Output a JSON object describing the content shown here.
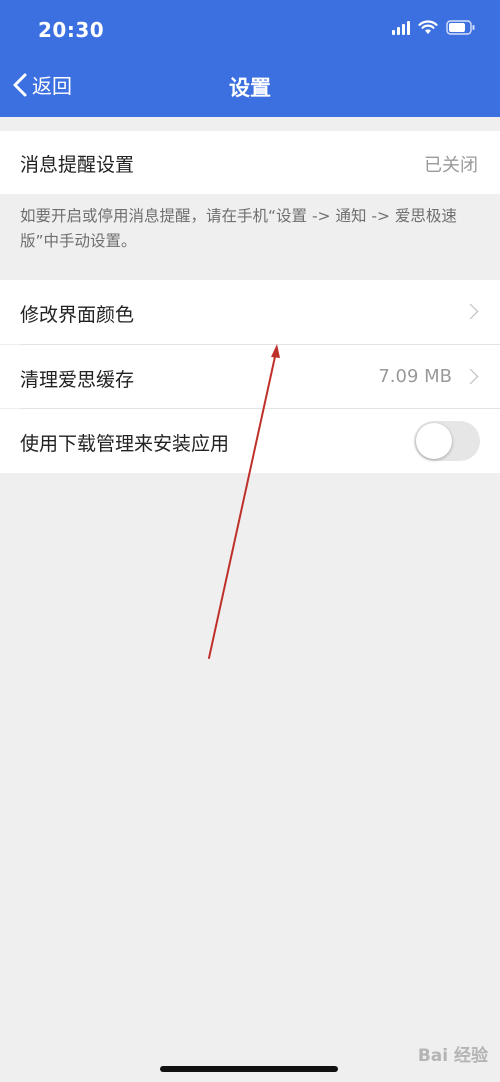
{
  "status_bar": {
    "time": "20:30"
  },
  "nav": {
    "back_label": "返回",
    "title": "设置",
    "background_color": "#3c6fe0"
  },
  "settings": {
    "notification": {
      "label": "消息提醒设置",
      "value": "已关闭"
    },
    "notification_note": "如要开启或停用消息提醒，请在手机“设置 -> 通知 -> 爱思极速版”中手动设置。",
    "theme_color": {
      "label": "修改界面颜色"
    },
    "clear_cache": {
      "label": "清理爱思缓存",
      "value": "7.09 MB"
    },
    "download_manager": {
      "label": "使用下载管理来安装应用",
      "enabled": false
    }
  },
  "annotation": {
    "arrow_color": "#c0302a"
  },
  "watermark": {
    "text": "Bai 经验"
  }
}
